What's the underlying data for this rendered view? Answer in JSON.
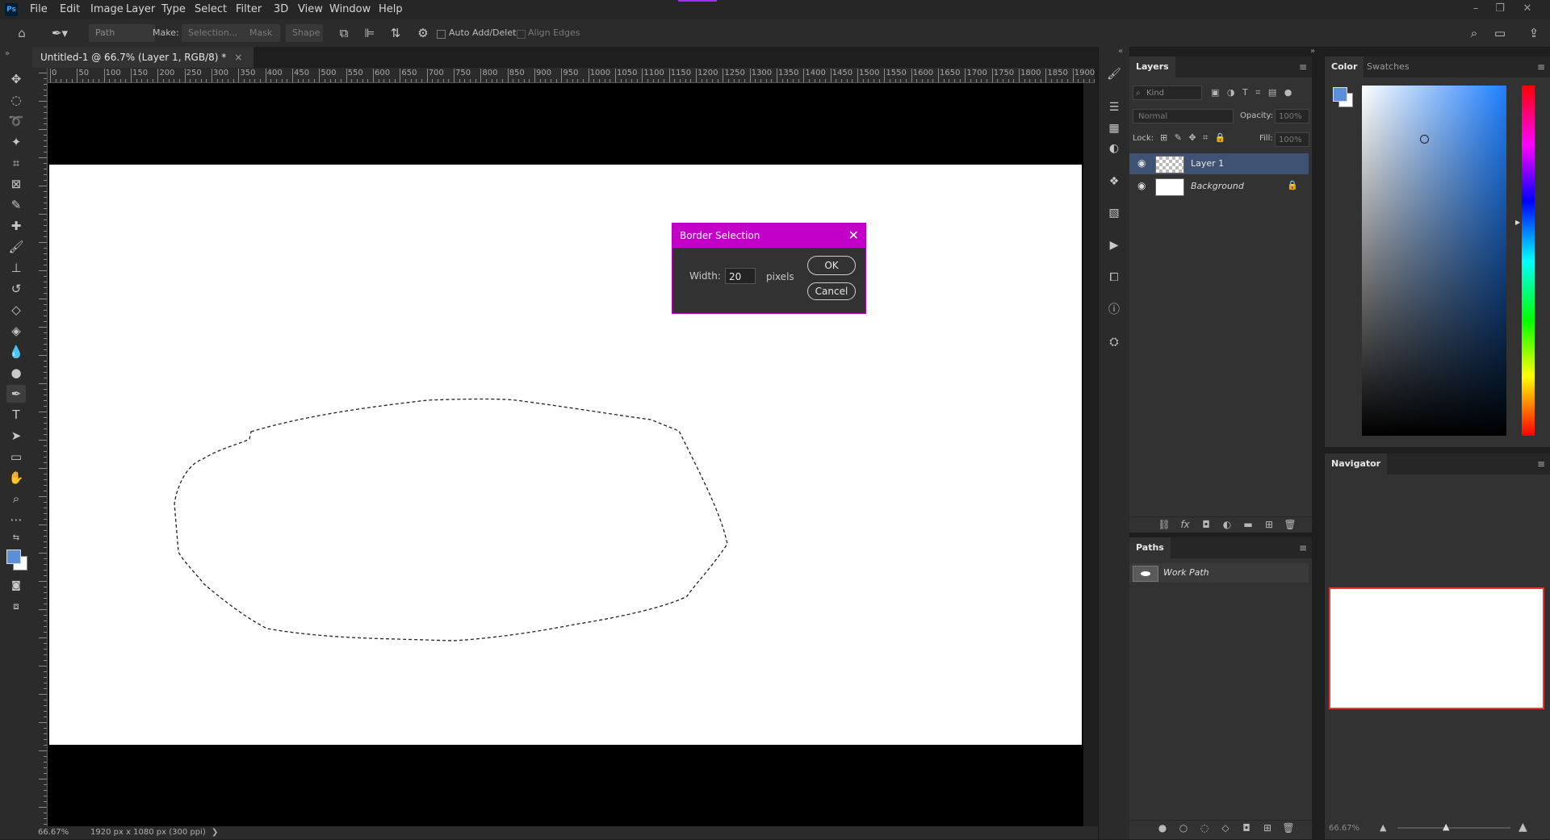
{
  "app": {
    "logo": "Ps"
  },
  "menu": [
    "File",
    "Edit",
    "Image",
    "Layer",
    "Type",
    "Select",
    "Filter",
    "3D",
    "View",
    "Window",
    "Help"
  ],
  "window_controls": {
    "minimize": "–",
    "restore": "❐",
    "close": "✕"
  },
  "options_bar": {
    "mode": "Path",
    "make_label": "Make:",
    "selection_btn": "Selection...",
    "mask_btn": "Mask",
    "shape_btn": "Shape",
    "auto_add_delete": "Auto Add/Delete",
    "align_edges": "Align Edges"
  },
  "document": {
    "tab_title": "Untitled-1 @ 66.7% (Layer 1, RGB/8) *",
    "close": "×",
    "ruler_labels": [
      "0",
      "50",
      "100",
      "150",
      "200",
      "250",
      "300",
      "350",
      "400",
      "450",
      "500",
      "550",
      "600",
      "650",
      "700",
      "750",
      "800",
      "850",
      "900",
      "950",
      "1000",
      "1050",
      "1100",
      "1150",
      "1200",
      "1250",
      "1300",
      "1350",
      "1400",
      "1450",
      "1500",
      "1550",
      "1600",
      "1650",
      "1700",
      "1750",
      "1800",
      "1850",
      "1900"
    ]
  },
  "dialog": {
    "title": "Border Selection",
    "width_label": "Width:",
    "width_value": "20",
    "unit": "pixels",
    "ok": "OK",
    "cancel": "Cancel"
  },
  "status": {
    "zoom": "66.67%",
    "doc_info": "1920 px x 1080 px (300 ppi)",
    "arrow": "❯"
  },
  "layers_panel": {
    "tab": "Layers",
    "kind_placeholder": "Kind",
    "blend_mode": "Normal",
    "opacity_label": "Opacity:",
    "opacity_value": "100%",
    "lock_label": "Lock:",
    "fill_label": "Fill:",
    "fill_value": "100%",
    "layers": [
      {
        "name": "Layer 1"
      },
      {
        "name": "Background"
      }
    ]
  },
  "paths_panel": {
    "tab": "Paths",
    "paths": [
      {
        "name": "Work Path"
      }
    ]
  },
  "color_panel": {
    "tab_color": "Color",
    "tab_swatches": "Swatches",
    "foreground": "#5b8fd8",
    "background": "#ffffff",
    "hue_color": "#1f7fff"
  },
  "navigator": {
    "tab": "Navigator",
    "zoom": "66.67%",
    "frame_color": "#e53935"
  },
  "colors": {
    "dialog_title_bg": "#c200c8",
    "selected_layer_bg": "#3f5274"
  }
}
